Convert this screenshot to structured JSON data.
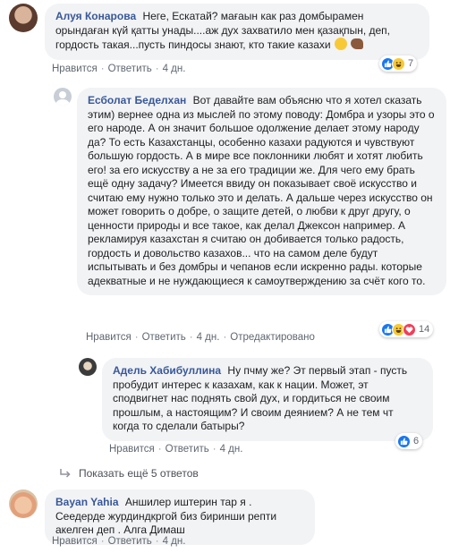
{
  "comments": [
    {
      "author": "Алуя Конарова",
      "text": "Неге, Ескатай? мағаын как раз домбырамен орындаған күй қатты унады....аж дух захватило мен қазақпын, деп, гордость такая...пусть пиндосы знают, кто такие казахи",
      "actions": [
        "Нравится",
        "Ответить",
        "4 дн."
      ],
      "reaction_count": "7",
      "reaction_icons": [
        "like-icon",
        "haha-icon"
      ]
    },
    {
      "author": "Есболат Беделхан",
      "text": "Вот давайте вам объясню что я хотел сказать этим) вернее одна из мыслей по этому поводу: Домбра и узоры это о его народе. А он значит большое одолжение делает этому народу да? То есть Казахстанцы, особенно казахи радуются и чувствуют большую гордость. А в мире все поклонники любят и хотят любить его! за его искусству а не за его традиции же. Для чего ему брать ещё одну задачу? Имеется ввиду он показывает своё искусство и считаю ему нужно только это и делать. А дальше через искусство он может говорить о добре, о защите детей, о любви к друг другу, о ценности природы и все такое, как делал Джексон например. А рекламируя казахстан я считаю он добивается только радость, гордость и довольство казахов... что на самом деле будут испытывать и без домбры и чепанов если искренно рады. которые адекватные и не нуждающиеся к самоутверждению за счёт кого то.",
      "actions": [
        "Нравится",
        "Ответить",
        "4 дн.",
        "Отредактировано"
      ],
      "reaction_count": "14",
      "reaction_icons": [
        "like-icon",
        "haha-icon",
        "love-icon"
      ]
    },
    {
      "author": "Адель Хабибуллина",
      "text": "Ну пчму же? Эт первый этап - пусть пробудит интерес к казахам, как к нации. Может, эт сподвигнет нас поднять свой дух, и гордиться не своим прошлым, а настоящим? И своим деянием? А не тем чт когда то сделали батыры?",
      "actions": [
        "Нравится",
        "Ответить",
        "4 дн."
      ],
      "reaction_count": "6",
      "reaction_icons": [
        "like-icon"
      ]
    },
    {
      "author": "Bayan Yahia",
      "text": "Аншилер иштерин тар я . Сеедерде журдиндкргой биз биринши репти акелген деп . Алга Димаш",
      "actions": [
        "Нравится",
        "Ответить",
        "4 дн."
      ]
    }
  ],
  "more_replies_label": "Показать ещё 5 ответов",
  "colors": {
    "author_link": "#385898",
    "bubble_bg": "#f2f3f5",
    "meta_text": "#606770",
    "like_blue": "#1877f2",
    "haha_yellow": "#f7c937",
    "love_red": "#f33e58"
  }
}
